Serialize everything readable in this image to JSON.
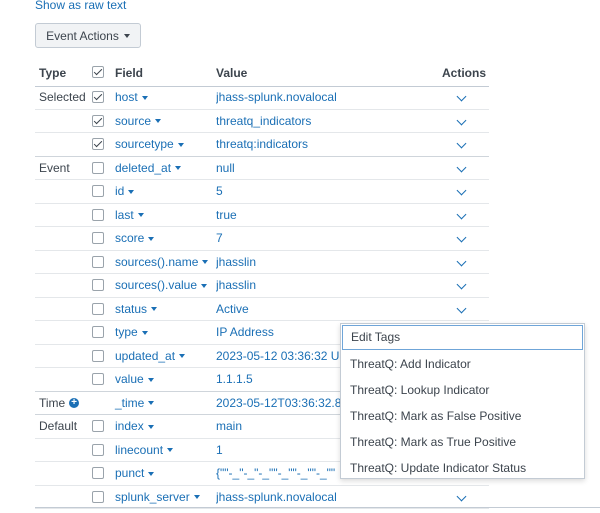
{
  "raw_link": "Show as raw text",
  "event_actions_label": "Event Actions",
  "headers": {
    "type": "Type",
    "field": "Field",
    "value": "Value",
    "actions": "Actions"
  },
  "rows": [
    {
      "group": "Selected",
      "checked": true,
      "field": "host",
      "value": "jhass-splunk.novalocal",
      "has_action": true
    },
    {
      "group": "",
      "checked": true,
      "field": "source",
      "value": "threatq_indicators",
      "has_action": true
    },
    {
      "group": "",
      "checked": true,
      "field": "sourcetype",
      "value": "threatq:indicators",
      "has_action": true
    },
    {
      "group": "Event",
      "checked": false,
      "field": "deleted_at",
      "value": "null",
      "has_action": true
    },
    {
      "group": "",
      "checked": false,
      "field": "id",
      "value": "5",
      "has_action": true
    },
    {
      "group": "",
      "checked": false,
      "field": "last",
      "value": "true",
      "has_action": true
    },
    {
      "group": "",
      "checked": false,
      "field": "score",
      "value": "7",
      "has_action": true
    },
    {
      "group": "",
      "checked": false,
      "field": "sources().name",
      "value": "jhasslin",
      "has_action": true
    },
    {
      "group": "",
      "checked": false,
      "field": "sources().value",
      "value": "jhasslin",
      "has_action": true
    },
    {
      "group": "",
      "checked": false,
      "field": "status",
      "value": "Active",
      "has_action": true
    },
    {
      "group": "",
      "checked": false,
      "field": "type",
      "value": "IP Address",
      "has_action": false
    },
    {
      "group": "",
      "checked": false,
      "field": "updated_at",
      "value": "2023-05-12 03:36:32 U",
      "has_action": false
    },
    {
      "group": "",
      "checked": false,
      "field": "value",
      "value": "1.1.1.5",
      "has_action": false
    },
    {
      "group": "Time",
      "checked": null,
      "field": "_time",
      "value": "2023-05-12T03:36:32.8",
      "has_action": false
    },
    {
      "group": "Default",
      "checked": false,
      "field": "index",
      "value": "main",
      "has_action": false
    },
    {
      "group": "",
      "checked": false,
      "field": "linecount",
      "value": "1",
      "has_action": false
    },
    {
      "group": "",
      "checked": false,
      "field": "punct",
      "value": "{\"\"-_\"-_\"-_\"\"-_\"\"-_\"\"-_\"\"",
      "has_action": false
    },
    {
      "group": "",
      "checked": false,
      "field": "splunk_server",
      "value": "jhass-splunk.novalocal",
      "has_action": true
    }
  ],
  "menu_items": [
    "Edit Tags",
    "ThreatQ: Add Indicator",
    "ThreatQ: Lookup Indicator",
    "ThreatQ: Mark as False Positive",
    "ThreatQ: Mark as True Positive",
    "ThreatQ: Update Indicator Status"
  ],
  "colors": {
    "link": "#1a6fb5",
    "text": "#3c444d",
    "border": "#c3cbd4"
  }
}
